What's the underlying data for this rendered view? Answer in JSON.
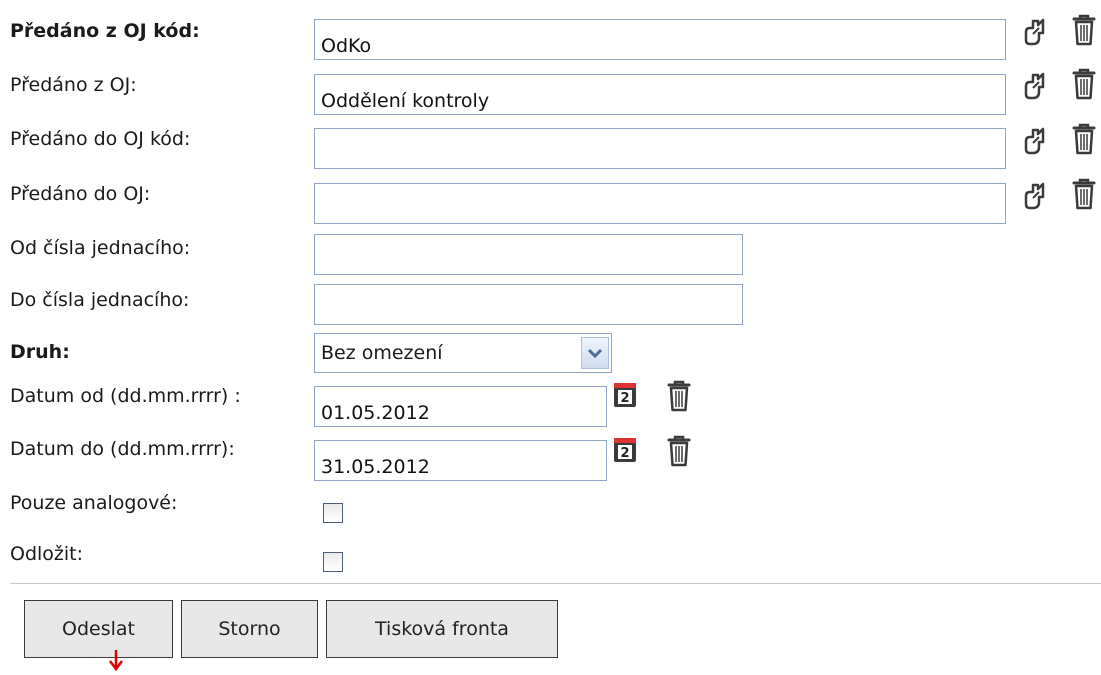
{
  "fields": [
    {
      "label": "Předáno z OJ kód:",
      "value": "OdKo"
    },
    {
      "label": "Předáno z OJ:",
      "value": "Oddělení kontroly"
    },
    {
      "label": "Předáno do OJ kód:",
      "value": ""
    },
    {
      "label": "Předáno do OJ:",
      "value": ""
    },
    {
      "label": "Od čísla jednacího:",
      "value": ""
    },
    {
      "label": "Do čísla jednacího:",
      "value": ""
    }
  ],
  "druh": {
    "label": "Druh:",
    "value": "Bez omezení"
  },
  "dates": [
    {
      "label": "Datum od (dd.mm.rrrr) :",
      "value": "01.05.2012"
    },
    {
      "label": "Datum do (dd.mm.rrrr):",
      "value": "31.05.2012"
    }
  ],
  "checkboxes": [
    {
      "label": "Pouze analogové:",
      "checked": false
    },
    {
      "label": "Odložit:",
      "checked": false
    }
  ],
  "buttons": {
    "submit": "Odeslat",
    "cancel": "Storno",
    "print_queue": "Tisková fronta"
  },
  "calendar_day": "2",
  "icons": {
    "select": "arrow-select-icon",
    "delete": "trash-icon",
    "calendar": "calendar-icon",
    "pointer": "red-arrow-icon"
  }
}
